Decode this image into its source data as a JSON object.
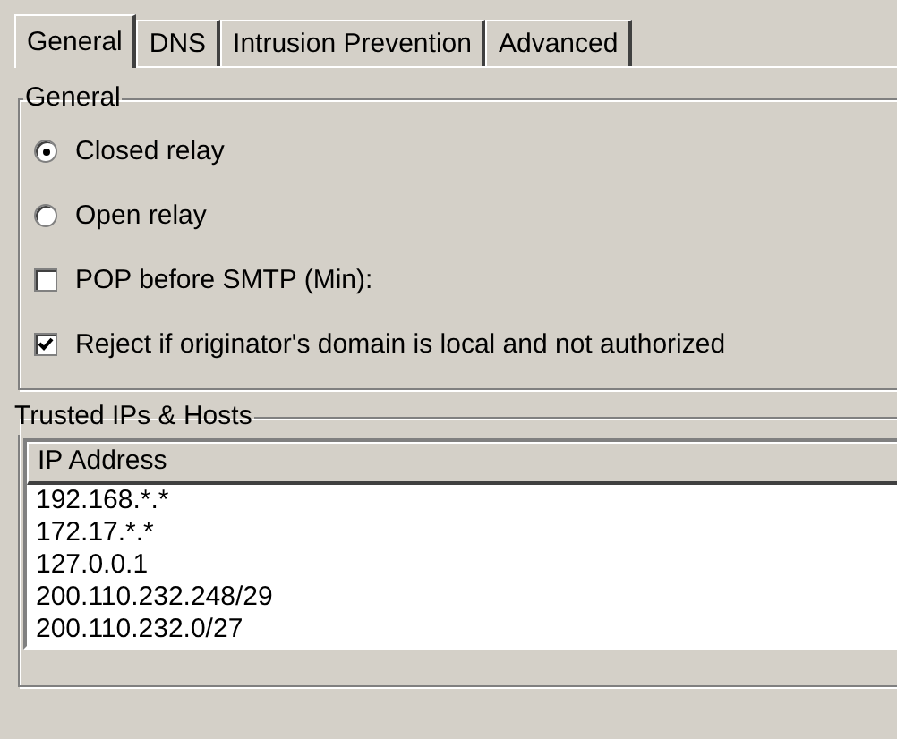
{
  "tabs": [
    {
      "label": "General",
      "selected": true
    },
    {
      "label": "DNS",
      "selected": false
    },
    {
      "label": "Intrusion Prevention",
      "selected": false
    },
    {
      "label": "Advanced",
      "selected": false
    }
  ],
  "general_group": {
    "title": "General",
    "options": [
      {
        "kind": "radio",
        "label": "Closed relay",
        "selected": true
      },
      {
        "kind": "radio",
        "label": "Open relay",
        "selected": false
      },
      {
        "kind": "checkbox",
        "label": "POP before SMTP (Min):",
        "checked": false
      },
      {
        "kind": "checkbox",
        "label": "Reject if originator's domain is local and not authorized",
        "checked": true
      }
    ]
  },
  "trusted_group": {
    "title": "Trusted IPs & Hosts",
    "list": {
      "columns": [
        "IP Address"
      ],
      "rows": [
        "192.168.*.*",
        "172.17.*.*",
        "127.0.0.1",
        "200.110.232.248/29",
        "200.110.232.0/27"
      ]
    }
  }
}
